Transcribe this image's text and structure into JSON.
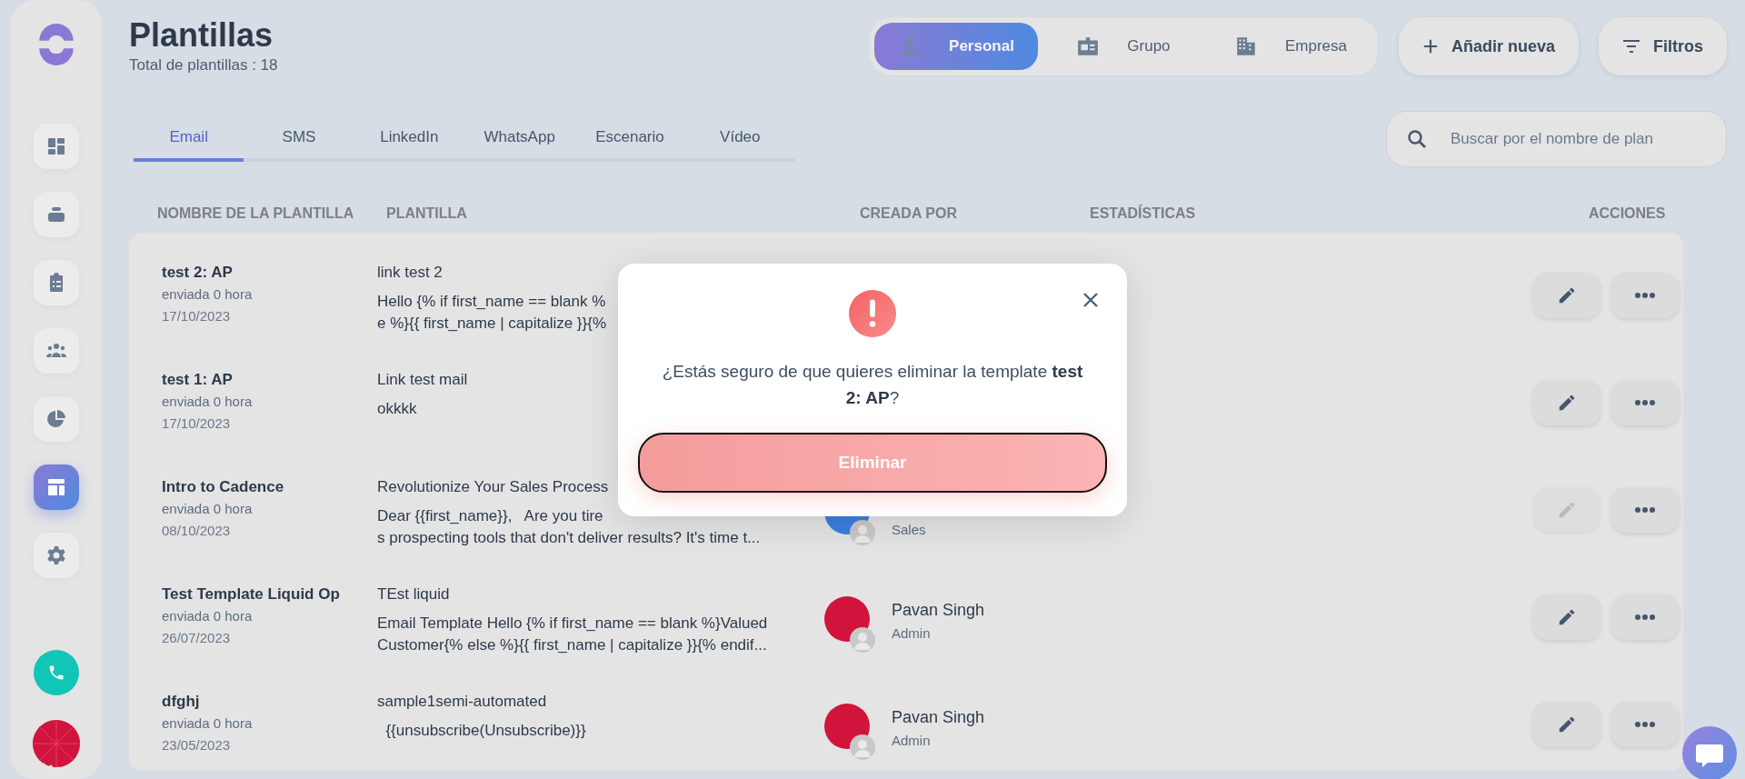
{
  "sidebar": {
    "items": [
      {
        "kind": "dashboard",
        "selected": false
      },
      {
        "kind": "stack",
        "selected": false
      },
      {
        "kind": "clipboard",
        "selected": false
      },
      {
        "kind": "people",
        "selected": false
      },
      {
        "kind": "pie",
        "selected": false
      },
      {
        "kind": "template",
        "selected": true
      },
      {
        "kind": "gear",
        "selected": false
      }
    ]
  },
  "header": {
    "title": "Plantillas",
    "subtitle": "Total de plantillas : 18"
  },
  "scope": [
    {
      "label": "Personal",
      "kind": "person",
      "selected": true
    },
    {
      "label": "Grupo",
      "kind": "badge",
      "selected": false
    },
    {
      "label": "Empresa",
      "kind": "building",
      "selected": false
    }
  ],
  "add_button": "Añadir nueva",
  "filter_button": "Filtros",
  "tabs": [
    {
      "label": "Email",
      "selected": true
    },
    {
      "label": "SMS",
      "selected": false
    },
    {
      "label": "LinkedIn",
      "selected": false
    },
    {
      "label": "WhatsApp",
      "selected": false
    },
    {
      "label": "Escenario",
      "selected": false
    },
    {
      "label": "Vídeo",
      "selected": false
    }
  ],
  "search": {
    "placeholder": "Buscar por el nombre de plan"
  },
  "table": {
    "columns": [
      "NOMBRE DE LA PLANTILLA",
      "PLANTILLA",
      "CREADA POR",
      "ESTADÍSTICAS",
      "ACCIONES"
    ],
    "rows": [
      {
        "name": "test 2: AP",
        "sent": "enviada 0 hora",
        "date": "17/10/2023",
        "subject": "link test 2",
        "body": [
          "Hello {% if first_name == blank %",
          "e %}{{ first_name | capitalize }}{%"
        ],
        "edit_disabled": false
      },
      {
        "name": "test 1: AP",
        "sent": "enviada 0 hora",
        "date": "17/10/2023",
        "subject": "Link test mail",
        "body": [
          "okkkk"
        ],
        "edit_disabled": false
      },
      {
        "name": "Intro to Cadence",
        "sent": "enviada 0 hora",
        "date": "08/10/2023",
        "subject": "Revolutionize Your Sales Process",
        "body": [
          "Dear {{first_name}},   Are you tire",
          "s prospecting tools that don't deliver results? It's time t..."
        ],
        "creator": {
          "role": "Sales",
          "color": "#3b7fe0"
        },
        "edit_disabled": true
      },
      {
        "name": "Test Template Liquid Op",
        "sent": "enviada 0 hora",
        "date": "26/07/2023",
        "subject": "TEst liquid",
        "body": [
          "Email Template Hello {% if first_name == blank %}Valued",
          "Customer{% else %}{{ first_name | capitalize }}{% endif..."
        ],
        "creator": {
          "name": "Pavan Singh",
          "role": "Admin",
          "color": "#d0143c"
        },
        "edit_disabled": false
      },
      {
        "name": "dfghj",
        "sent": "enviada 0 hora",
        "date": "23/05/2023",
        "subject": "sample1semi-automated",
        "body": [
          "  {{unsubscribe(Unsubscribe)}}"
        ],
        "creator": {
          "name": "Pavan Singh",
          "role": "Admin",
          "color": "#d0143c"
        },
        "edit_disabled": false
      }
    ]
  },
  "dialog": {
    "message": "¿Estás seguro de que quieres eliminar la template **test 2: AP**?",
    "button": "Eliminar"
  }
}
